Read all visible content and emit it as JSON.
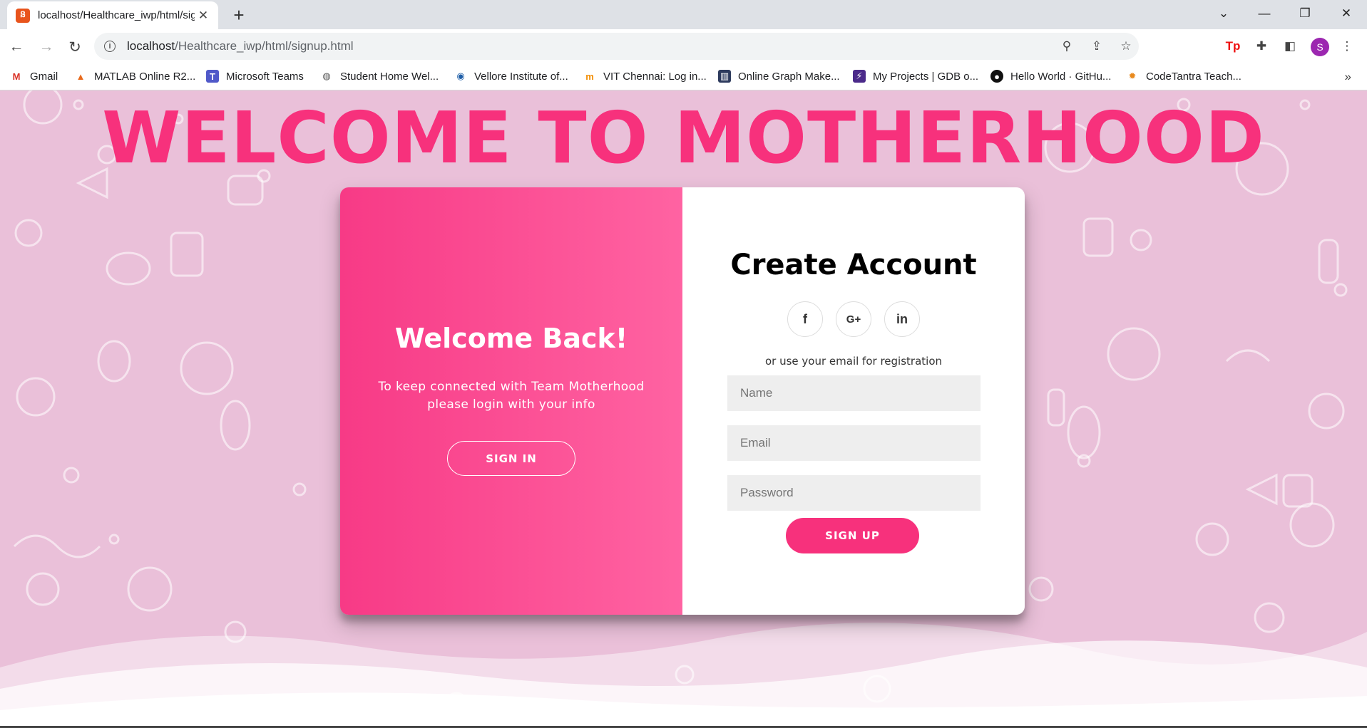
{
  "browser": {
    "tab": {
      "title": "localhost/Healthcare_iwp/html/signup.html",
      "favicon": "xampp-icon"
    },
    "address": {
      "host": "localhost",
      "path": "/Healthcare_iwp/html/signup.html"
    },
    "profile_initial": "S",
    "bookmarks": [
      {
        "label": "Gmail",
        "icon": "gmail-icon"
      },
      {
        "label": "MATLAB Online R2...",
        "icon": "matlab-icon"
      },
      {
        "label": "Microsoft Teams",
        "icon": "teams-icon"
      },
      {
        "label": "Student Home Wel...",
        "icon": "globe-icon"
      },
      {
        "label": "Vellore Institute of...",
        "icon": "vit-icon"
      },
      {
        "label": "VIT Chennai: Log in...",
        "icon": "moodle-icon"
      },
      {
        "label": "Online Graph Make...",
        "icon": "graph-icon"
      },
      {
        "label": "My Projects | GDB o...",
        "icon": "gdb-icon"
      },
      {
        "label": "Hello World · GitHu...",
        "icon": "github-icon"
      },
      {
        "label": "CodeTantra Teach...",
        "icon": "codetantra-icon"
      }
    ]
  },
  "page": {
    "hero_title": "WELCOME TO MOTHERHOOD",
    "overlay": {
      "title": "Welcome Back!",
      "text": "To keep connected with Team Motherhood please login with your info",
      "signin_label": "SIGN IN"
    },
    "form": {
      "title": "Create Account",
      "social": [
        {
          "label": "f",
          "icon": "facebook-icon"
        },
        {
          "label": "G+",
          "icon": "google-plus-icon"
        },
        {
          "label": "in",
          "icon": "linkedin-icon"
        }
      ],
      "hint": "or use your email for registration",
      "name_placeholder": "Name",
      "email_placeholder": "Email",
      "password_placeholder": "Password",
      "signup_label": "SIGN UP"
    }
  },
  "colors": {
    "accent": "#f7317c",
    "gradient_start": "#f73a86",
    "gradient_end": "#ff63a2",
    "background": "#eac0d9"
  }
}
